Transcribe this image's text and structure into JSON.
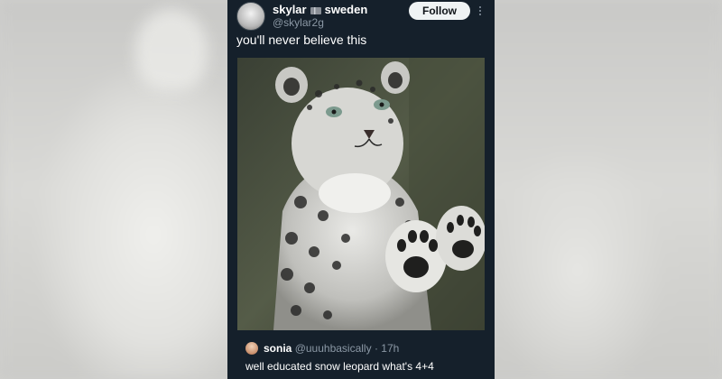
{
  "post": {
    "author_name": "skylar",
    "author_name_suffix": "sweden",
    "handle": "@skylar2g",
    "follow_label": "Follow",
    "text": "you'll never believe this"
  },
  "reply": {
    "name": "sonia",
    "handle": "@uuuhbasically",
    "time": "· 17h",
    "text": "well educated snow leopard what's 4+4"
  },
  "colors": {
    "card_background": "#15202b",
    "follow_button": "#eff3f4",
    "secondary_text": "#8b98a5"
  }
}
